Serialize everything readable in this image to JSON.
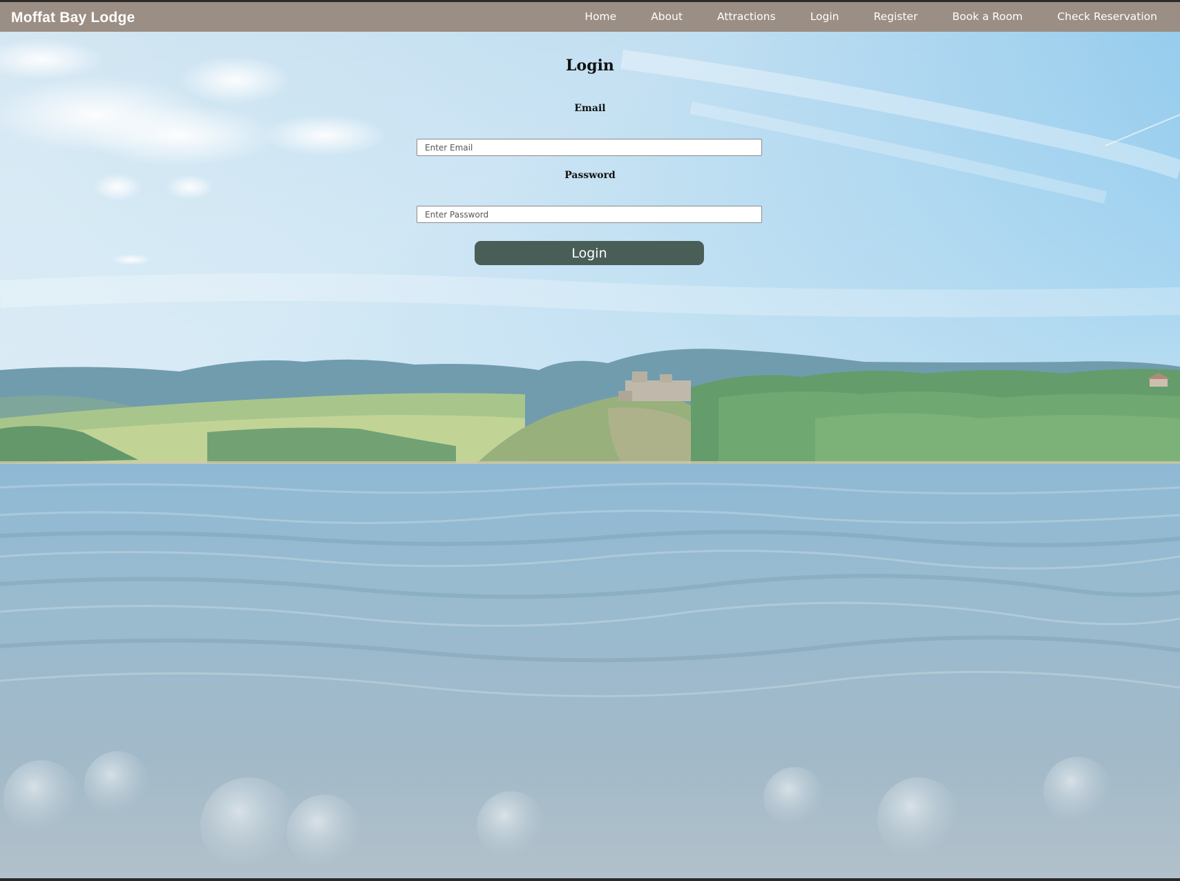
{
  "brand": "Moffat Bay Lodge",
  "nav": {
    "items": [
      {
        "label": "Home"
      },
      {
        "label": "About"
      },
      {
        "label": "Attractions"
      },
      {
        "label": "Login"
      },
      {
        "label": "Register"
      },
      {
        "label": "Book a Room"
      },
      {
        "label": "Check Reservation"
      }
    ]
  },
  "login": {
    "title": "Login",
    "email_label": "Email",
    "email_placeholder": "Enter Email",
    "password_label": "Password",
    "password_placeholder": "Enter Password",
    "submit_label": "Login"
  },
  "colors": {
    "navbar": "#9b8e84",
    "button": "#4a5e58",
    "sky_top": "#79b9e0",
    "water": "#86aec6"
  }
}
